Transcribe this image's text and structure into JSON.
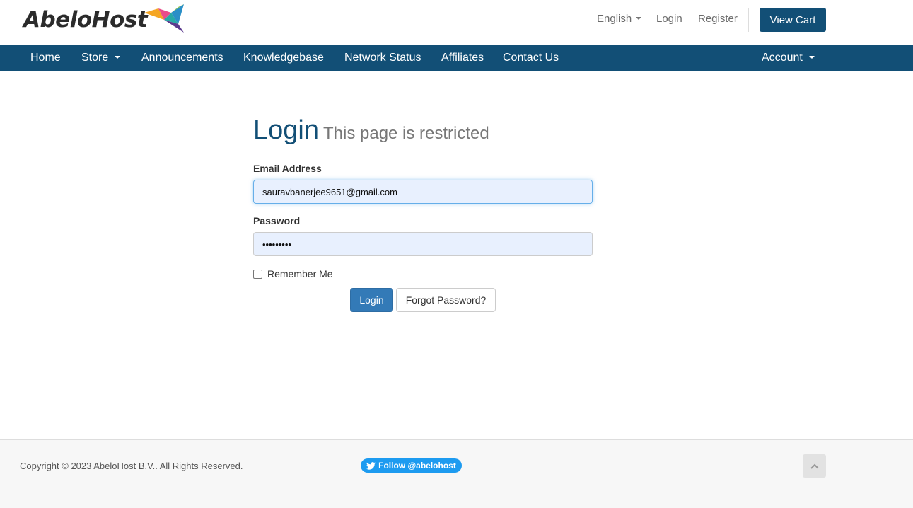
{
  "brand": {
    "name": "AbeloHost"
  },
  "topbar": {
    "language": "English",
    "login": "Login",
    "register": "Register",
    "view_cart": "View Cart"
  },
  "nav": {
    "items": [
      {
        "label": "Home"
      },
      {
        "label": "Store"
      },
      {
        "label": "Announcements"
      },
      {
        "label": "Knowledgebase"
      },
      {
        "label": "Network Status"
      },
      {
        "label": "Affiliates"
      },
      {
        "label": "Contact Us"
      }
    ],
    "account": "Account"
  },
  "login_form": {
    "title": "Login",
    "subtitle": "This page is restricted",
    "email_label": "Email Address",
    "email_value": "sauravbanerjee9651@gmail.com",
    "password_label": "Password",
    "password_value": "•••••••••",
    "remember_label": "Remember Me",
    "login_button": "Login",
    "forgot_button": "Forgot Password?"
  },
  "footer": {
    "copyright": "Copyright © 2023 AbeloHost B.V.. All Rights Reserved.",
    "twitter_follow": "Follow @abelohost"
  },
  "colors": {
    "primary": "#124f76",
    "button_blue": "#337ab7",
    "twitter": "#1d9bf0"
  }
}
